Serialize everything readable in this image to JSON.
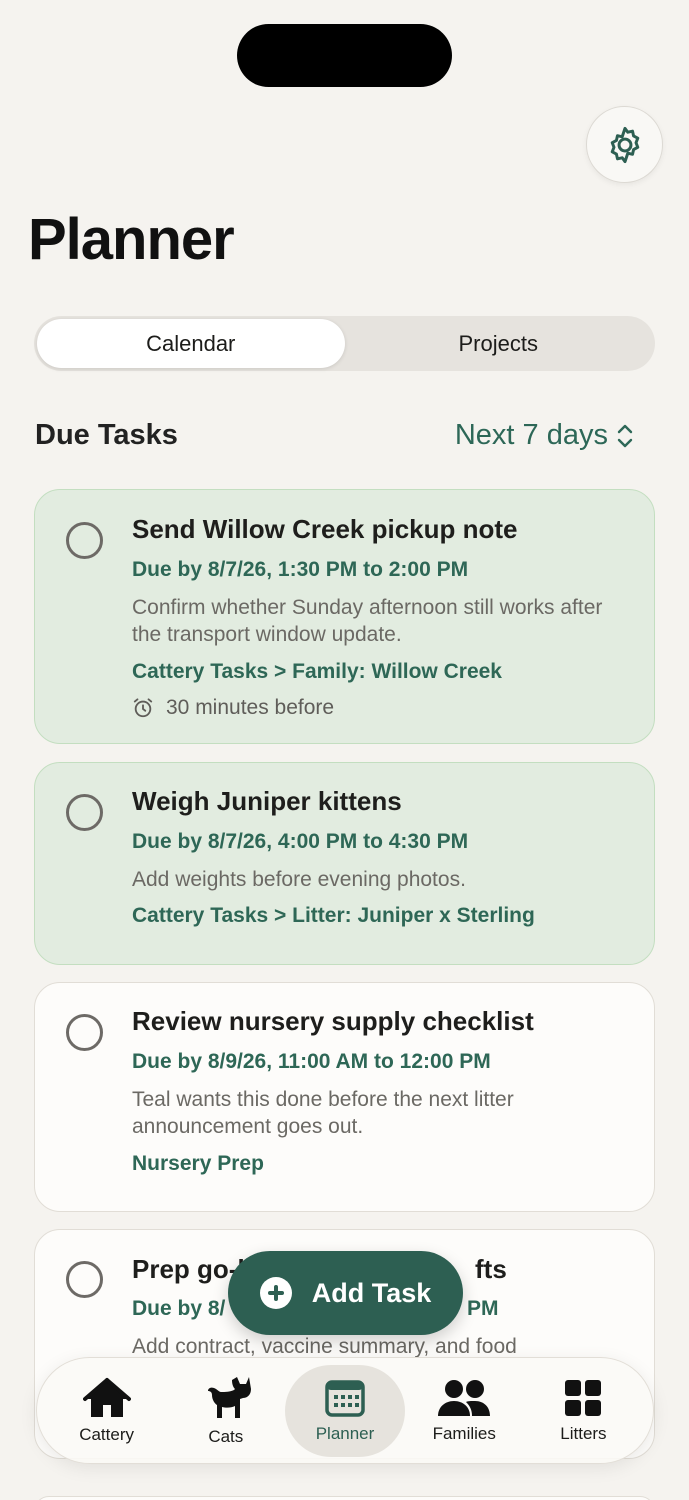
{
  "header": {
    "title": "Planner",
    "settings_icon": "gear-icon"
  },
  "segments": [
    {
      "label": "Calendar",
      "active": true
    },
    {
      "label": "Projects",
      "active": false
    }
  ],
  "due_tasks": {
    "title": "Due Tasks",
    "range": "Next 7 days"
  },
  "tasks": [
    {
      "title": "Send Willow Creek pickup note",
      "due": "Due by 8/7/26, 1:30 PM to 2:00 PM",
      "description": "Confirm whether Sunday afternoon still works after the transport window update.",
      "path": "Cattery Tasks > Family: Willow Creek",
      "reminder": "30 minutes before",
      "highlighted": true
    },
    {
      "title": "Weigh Juniper kittens",
      "due": "Due by 8/7/26, 4:00 PM to 4:30 PM",
      "description": "Add weights before evening photos.",
      "path": "Cattery Tasks > Litter: Juniper x Sterling",
      "highlighted": true
    },
    {
      "title": "Review nursery supply checklist",
      "due": "Due by 8/9/26, 11:00 AM to 12:00 PM",
      "description": "Teal wants this done before the next litter announcement goes out.",
      "path": "Nursery Prep",
      "highlighted": false
    },
    {
      "title": "Prep go-h",
      "title_tail": "fts",
      "due": "Due by 8/",
      "due_tail": "PM",
      "description": "Add contract, vaccine summary, and food",
      "highlighted": false
    }
  ],
  "fab": {
    "label": "Add Task",
    "icon": "plus-circle-icon"
  },
  "tabbar": [
    {
      "label": "Cattery",
      "icon": "house-icon",
      "active": false
    },
    {
      "label": "Cats",
      "icon": "cat-icon",
      "active": false
    },
    {
      "label": "Planner",
      "icon": "calendar-icon",
      "active": true
    },
    {
      "label": "Families",
      "icon": "people-icon",
      "active": false
    },
    {
      "label": "Litters",
      "icon": "grid-icon",
      "active": false
    }
  ],
  "colors": {
    "accent": "#2d5f52",
    "accent_text": "#2e6756",
    "highlight_card": "#e2ece0",
    "background": "#f5f3ef"
  }
}
